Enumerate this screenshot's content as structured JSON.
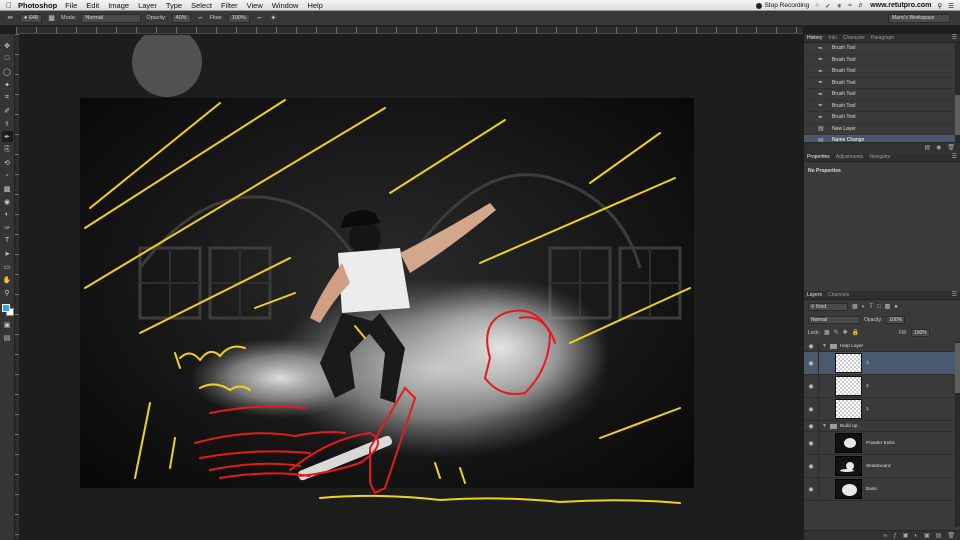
{
  "menubar": {
    "app": "Photoshop",
    "menus": [
      "File",
      "Edit",
      "Image",
      "Layer",
      "Type",
      "Select",
      "Filter",
      "View",
      "Window",
      "Help"
    ],
    "stop_recording": "Stop Recording",
    "url": "www.retutpro.com"
  },
  "options": {
    "brush_size": "648",
    "mode_label": "Mode:",
    "mode_value": "Normal",
    "opacity_label": "Opacity:",
    "opacity_value": "40%",
    "flow_label": "Flow:",
    "flow_value": "100%",
    "workspace": "Marni's Workspace"
  },
  "ruler": {
    "ticks": [
      "6",
      "4",
      "2",
      "0",
      "2",
      "4",
      "6",
      "8",
      "10",
      "12",
      "14",
      "16",
      "18",
      "20",
      "22",
      "24",
      "26",
      "28",
      "30",
      "32",
      "34",
      "36",
      "38",
      "40",
      "42"
    ]
  },
  "history": {
    "tabs": [
      "History",
      "Info",
      "Character",
      "Paragraph"
    ],
    "items": [
      {
        "label": "Brush Tool",
        "selected": false
      },
      {
        "label": "Brush Tool",
        "selected": false
      },
      {
        "label": "Brush Tool",
        "selected": false
      },
      {
        "label": "Brush Tool",
        "selected": false
      },
      {
        "label": "Brush Tool",
        "selected": false
      },
      {
        "label": "Brush Tool",
        "selected": false
      },
      {
        "label": "Brush Tool",
        "selected": false
      },
      {
        "label": "New Layer",
        "selected": false
      },
      {
        "label": "Name Change",
        "selected": true
      }
    ]
  },
  "properties": {
    "tabs": [
      "Properties",
      "Adjustments",
      "Navigator"
    ],
    "empty_text": "No Properties"
  },
  "layers": {
    "tabs": [
      "Layers",
      "Channels"
    ],
    "filter_kind": "Kind",
    "blend_mode": "Normal",
    "opacity_label": "Opacity:",
    "opacity_value": "100%",
    "lock_label": "Lock:",
    "fill_label": "Fill:",
    "fill_value": "100%",
    "rows": [
      {
        "type": "group",
        "name": "Help Layer"
      },
      {
        "type": "layer",
        "name": "3",
        "selected": true,
        "thumb": "checker"
      },
      {
        "type": "layer",
        "name": "2",
        "thumb": "checker"
      },
      {
        "type": "layer",
        "name": "1",
        "thumb": "checker"
      },
      {
        "type": "group",
        "name": "Build up"
      },
      {
        "type": "layer",
        "name": "Powder Extra",
        "thumb": "dark"
      },
      {
        "type": "layer",
        "name": "Skateboard",
        "thumb": "dark"
      },
      {
        "type": "layer",
        "name": "Basic",
        "thumb": "dark"
      }
    ]
  },
  "toolbar": {
    "foreground_color": "#27a7e3",
    "background_color": "#ffffff",
    "tools": [
      "move-icon",
      "marquee-icon",
      "lasso-icon",
      "quick-select-icon",
      "crop-icon",
      "eyedropper-icon",
      "healing-icon",
      "brush-icon",
      "clone-stamp-icon",
      "history-brush-icon",
      "eraser-icon",
      "gradient-icon",
      "blur-icon",
      "dodge-icon",
      "pen-icon",
      "type-icon",
      "path-select-icon",
      "shape-icon",
      "hand-icon",
      "zoom-icon"
    ]
  }
}
